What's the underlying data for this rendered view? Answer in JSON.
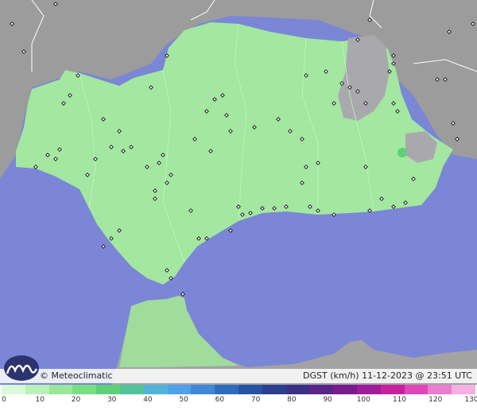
{
  "map": {
    "credit": "© Meteoclimatic",
    "caption": "DGST (km/h)  11-12-2023 @ 23:51 UTC",
    "colors": {
      "sea": "#7b86d6",
      "land_outside": "#9c9c9c",
      "region": "#a3e7a0",
      "highlands": "#a9a9ad",
      "border": "#ffffff"
    },
    "station_marker": "diamond"
  },
  "legend": {
    "ticks": [
      "0",
      "10",
      "20",
      "30",
      "40",
      "50",
      "60",
      "70",
      "80",
      "90",
      "100",
      "110",
      "120",
      "130"
    ],
    "colors": [
      "#d9fbd9",
      "#b8f2b8",
      "#98e898",
      "#78de82",
      "#5fcf7a",
      "#50c39a",
      "#52b3d8",
      "#4fa1ec",
      "#3f87d8",
      "#2e6cc0",
      "#2554a6",
      "#2a3f8e",
      "#3b2f87",
      "#5a2489",
      "#7a1b8f",
      "#a01c98",
      "#c8209f",
      "#e046b8",
      "#ec7ccd",
      "#f4b0e0"
    ]
  }
}
